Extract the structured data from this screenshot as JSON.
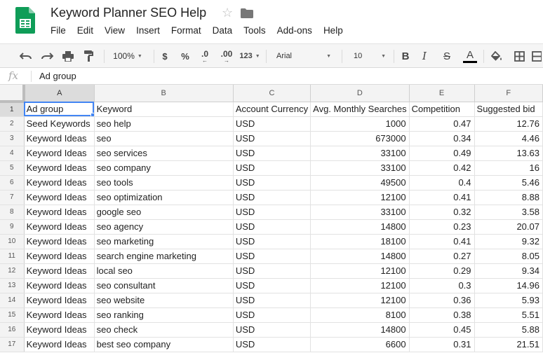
{
  "doc": {
    "title": "Keyword Planner SEO Help"
  },
  "menu": [
    "File",
    "Edit",
    "View",
    "Insert",
    "Format",
    "Data",
    "Tools",
    "Add-ons",
    "Help"
  ],
  "toolbar": {
    "zoom": "100%",
    "currency": "$",
    "percent": "%",
    "decrease_decimal": ".0",
    "increase_decimal": ".00",
    "more_formats": "123",
    "font": "Arial",
    "font_size": "10"
  },
  "formula": {
    "fx_label": "fx",
    "value": "Ad group"
  },
  "grid": {
    "columns": [
      "A",
      "B",
      "C",
      "D",
      "E",
      "F"
    ],
    "selected_column": "A",
    "selected_row": "1",
    "rows": [
      [
        "1",
        "Ad group",
        "Keyword",
        "Account Currency",
        "Avg. Monthly Searches",
        "Competition",
        "Suggested bid"
      ],
      [
        "2",
        "Seed Keywords",
        "seo help",
        "USD",
        "1000",
        "0.47",
        "12.76"
      ],
      [
        "3",
        "Keyword Ideas",
        "seo",
        "USD",
        "673000",
        "0.34",
        "4.46"
      ],
      [
        "4",
        "Keyword Ideas",
        "seo services",
        "USD",
        "33100",
        "0.49",
        "13.63"
      ],
      [
        "5",
        "Keyword Ideas",
        "seo company",
        "USD",
        "33100",
        "0.42",
        "16"
      ],
      [
        "6",
        "Keyword Ideas",
        "seo tools",
        "USD",
        "49500",
        "0.4",
        "5.46"
      ],
      [
        "7",
        "Keyword Ideas",
        "seo optimization",
        "USD",
        "12100",
        "0.41",
        "8.88"
      ],
      [
        "8",
        "Keyword Ideas",
        "google seo",
        "USD",
        "33100",
        "0.32",
        "3.58"
      ],
      [
        "9",
        "Keyword Ideas",
        "seo agency",
        "USD",
        "14800",
        "0.23",
        "20.07"
      ],
      [
        "10",
        "Keyword Ideas",
        "seo marketing",
        "USD",
        "18100",
        "0.41",
        "9.32"
      ],
      [
        "11",
        "Keyword Ideas",
        "search engine marketing",
        "USD",
        "14800",
        "0.27",
        "8.05"
      ],
      [
        "12",
        "Keyword Ideas",
        "local seo",
        "USD",
        "12100",
        "0.29",
        "9.34"
      ],
      [
        "13",
        "Keyword Ideas",
        "seo consultant",
        "USD",
        "12100",
        "0.3",
        "14.96"
      ],
      [
        "14",
        "Keyword Ideas",
        "seo website",
        "USD",
        "12100",
        "0.36",
        "5.93"
      ],
      [
        "15",
        "Keyword Ideas",
        "seo ranking",
        "USD",
        "8100",
        "0.38",
        "5.51"
      ],
      [
        "16",
        "Keyword Ideas",
        "seo check",
        "USD",
        "14800",
        "0.45",
        "5.88"
      ],
      [
        "17",
        "Keyword Ideas",
        "best seo company",
        "USD",
        "6600",
        "0.31",
        "21.51"
      ]
    ]
  },
  "colors": {
    "sheets_green": "#0f9d58",
    "selection_blue": "#4285f4",
    "text_color_bar": "#000000"
  }
}
